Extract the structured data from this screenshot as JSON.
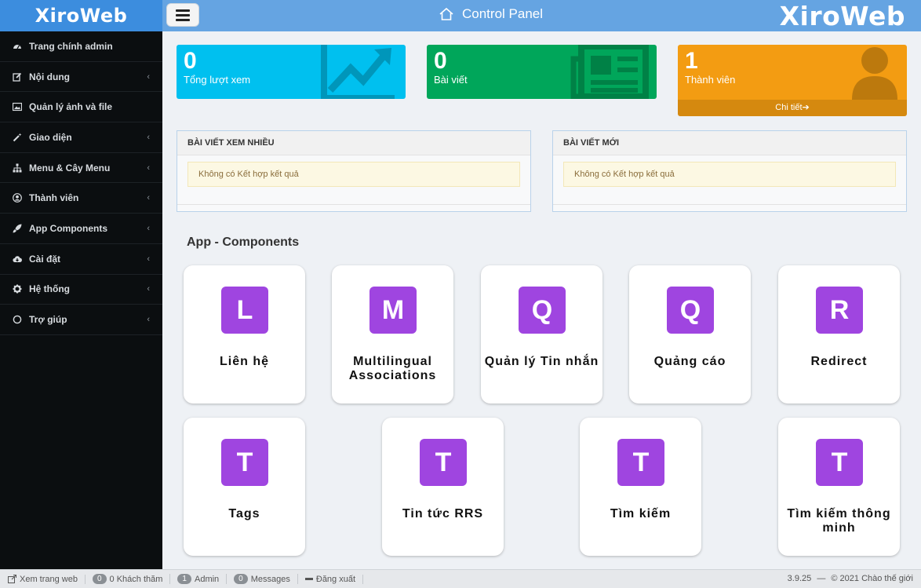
{
  "brand": {
    "name": "XiroWeb"
  },
  "topbar": {
    "title": "Control Panel",
    "logo": "XiroWeb"
  },
  "sidebar": {
    "items": [
      {
        "label": "Trang chính admin",
        "icon": "dashboard-icon",
        "has_submenu": false
      },
      {
        "label": "Nội dung",
        "icon": "edit-icon",
        "has_submenu": true
      },
      {
        "label": "Quản lý ảnh và file",
        "icon": "image-icon",
        "has_submenu": false
      },
      {
        "label": "Giao diện",
        "icon": "magic-wand-icon",
        "has_submenu": true
      },
      {
        "label": "Menu & Cây Menu",
        "icon": "sitemap-icon",
        "has_submenu": true
      },
      {
        "label": "Thành viên",
        "icon": "user-circle-icon",
        "has_submenu": true
      },
      {
        "label": "App Components",
        "icon": "rocket-icon",
        "has_submenu": true
      },
      {
        "label": "Cài đặt",
        "icon": "cloud-download-icon",
        "has_submenu": true
      },
      {
        "label": "Hệ thống",
        "icon": "gear-icon",
        "has_submenu": true
      },
      {
        "label": "Trợ giúp",
        "icon": "circle-icon",
        "has_submenu": true
      }
    ]
  },
  "stats": [
    {
      "value": "0",
      "label": "Tổng lượt xem",
      "color": "#00c0ef",
      "icon": "chart-line-icon"
    },
    {
      "value": "0",
      "label": "Bài viết",
      "color": "#00a65a",
      "icon": "newspaper-icon"
    },
    {
      "value": "1",
      "label": "Thành viên",
      "color": "#f39c12",
      "icon": "user-icon",
      "more": "Chi tiết"
    }
  ],
  "panels": [
    {
      "title": "BÀI VIẾT XEM NHIỀU",
      "message": "Không có Kết hợp kết quả"
    },
    {
      "title": "BÀI VIẾT MỚI",
      "message": "Không có Kết hợp kết quả"
    }
  ],
  "components": {
    "title": "App - Components",
    "items": [
      {
        "letter": "L",
        "name": "Liên hệ"
      },
      {
        "letter": "M",
        "name": "Multilingual Associations"
      },
      {
        "letter": "Q",
        "name": "Quản lý Tin nhắn"
      },
      {
        "letter": "Q",
        "name": "Quảng cáo"
      },
      {
        "letter": "R",
        "name": "Redirect"
      },
      {
        "letter": "T",
        "name": "Tags"
      },
      {
        "letter": "T",
        "name": "Tin tức RRS"
      },
      {
        "letter": "T",
        "name": "Tìm kiếm"
      },
      {
        "letter": "T",
        "name": "Tìm kiếm thông minh"
      }
    ],
    "badge_color": "#9f45e0"
  },
  "footer": {
    "view_site": "Xem trang web",
    "visitors_count": "0",
    "visitors_label": "0 Khách thăm",
    "admin_count": "1",
    "admin_label": "Admin",
    "messages_count": "0",
    "messages_label": "Messages",
    "logout": "Đăng xuất",
    "version": "3.9.25",
    "separator": "—",
    "copyright": "© 2021 Chào thế giới"
  }
}
